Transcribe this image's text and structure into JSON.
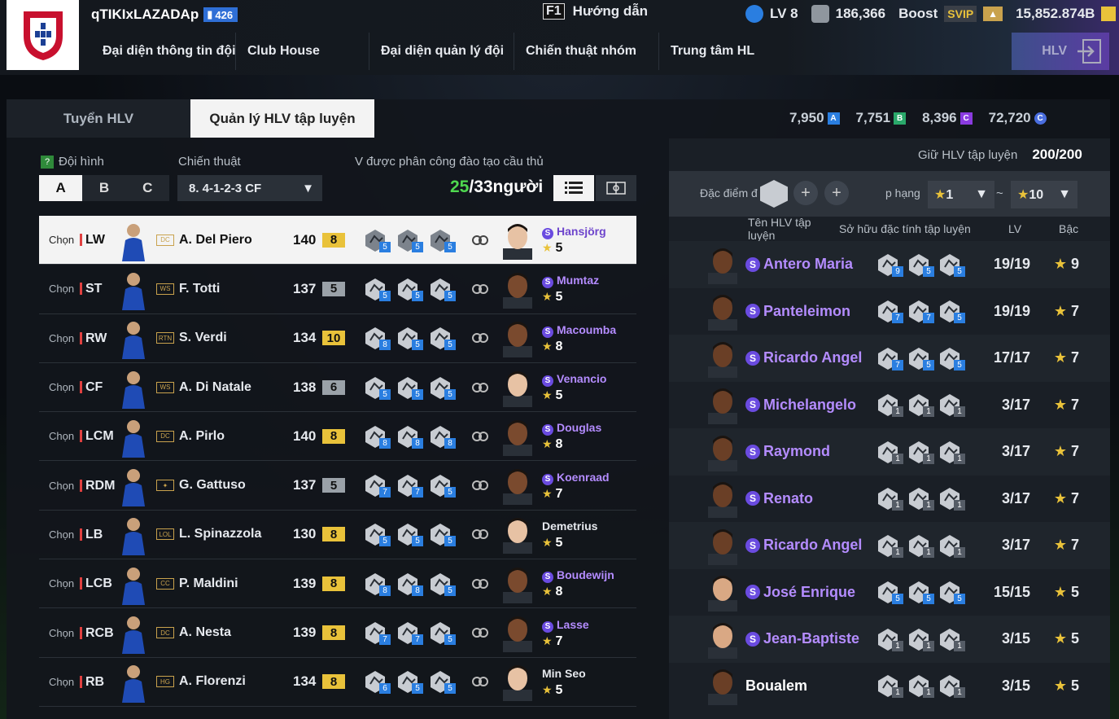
{
  "topbar": {
    "team_name": "qTIKIxLAZADAp",
    "team_level": "426",
    "guide_key": "F1",
    "guide_label": "Hướng dẫn",
    "level": "LV 8",
    "coins": "186,366",
    "boost_label": "Boost",
    "svip_label": "SVIP",
    "bp": "15,852.874B",
    "hlv_label": "HLV"
  },
  "nav": [
    "Đại diện thông tin đội",
    "Club House",
    "Đại diện quản lý đội",
    "Chiến thuật nhóm",
    "Trung tâm HL"
  ],
  "tabs": [
    "Tuyển HLV",
    "Quản lý HLV tập luyện"
  ],
  "currencies": [
    {
      "value": "7,950",
      "badge": "A",
      "color": "#2a7ee0"
    },
    {
      "value": "7,751",
      "badge": "B",
      "color": "#2aa86a"
    },
    {
      "value": "8,396",
      "badge": "C",
      "color": "#8a3be0"
    },
    {
      "value": "72,720",
      "badge": "C",
      "color": "#4a6ee0"
    }
  ],
  "left": {
    "formation_label": "Đội hình",
    "tactics_label": "Chiến thuật",
    "assigned_label": "V được phân công đào tạo cầu thủ",
    "formation_options": [
      "A",
      "B",
      "C"
    ],
    "tactic_value": "8. 4-1-2-3 CF",
    "assigned_count": "25",
    "assigned_total": "/33người"
  },
  "players": [
    {
      "choose": "Chọn",
      "pos": "LW",
      "season": "DC",
      "name": "A. Del Piero",
      "ovr": "140",
      "lvl": "8",
      "lvl_type": "gold",
      "traits": [
        "5",
        "5",
        "5"
      ],
      "coach": "Hansjörg",
      "coach_special": true,
      "stars": "5"
    },
    {
      "choose": "Chọn",
      "pos": "ST",
      "season": "WS",
      "name": "F. Totti",
      "ovr": "137",
      "lvl": "5",
      "lvl_type": "grey",
      "traits": [
        "5",
        "5",
        "5"
      ],
      "coach": "Mumtaz",
      "coach_special": true,
      "stars": "5"
    },
    {
      "choose": "Chọn",
      "pos": "RW",
      "season": "RTN",
      "name": "S. Verdi",
      "ovr": "134",
      "lvl": "10",
      "lvl_type": "gold",
      "traits": [
        "8",
        "5",
        "5"
      ],
      "coach": "Macoumba",
      "coach_special": true,
      "stars": "8"
    },
    {
      "choose": "Chọn",
      "pos": "CF",
      "season": "WS",
      "name": "A. Di Natale",
      "ovr": "138",
      "lvl": "6",
      "lvl_type": "grey",
      "traits": [
        "5",
        "5",
        "5"
      ],
      "coach": "Venancio",
      "coach_special": true,
      "stars": "5"
    },
    {
      "choose": "Chọn",
      "pos": "LCM",
      "season": "DC",
      "name": "A. Pirlo",
      "ovr": "140",
      "lvl": "8",
      "lvl_type": "gold",
      "traits": [
        "8",
        "8",
        "8"
      ],
      "coach": "Douglas",
      "coach_special": true,
      "stars": "8"
    },
    {
      "choose": "Chọn",
      "pos": "RDM",
      "season": "",
      "name": "G. Gattuso",
      "ovr": "137",
      "lvl": "5",
      "lvl_type": "grey",
      "traits": [
        "7",
        "7",
        "5"
      ],
      "coach": "Koenraad",
      "coach_special": true,
      "stars": "7"
    },
    {
      "choose": "Chọn",
      "pos": "LB",
      "season": "LOL",
      "name": "L. Spinazzola",
      "ovr": "130",
      "lvl": "8",
      "lvl_type": "gold",
      "traits": [
        "5",
        "5",
        "5"
      ],
      "coach": "Demetrius",
      "coach_special": false,
      "stars": "5"
    },
    {
      "choose": "Chọn",
      "pos": "LCB",
      "season": "CC",
      "name": "P. Maldini",
      "ovr": "139",
      "lvl": "8",
      "lvl_type": "gold",
      "traits": [
        "8",
        "8",
        "5"
      ],
      "coach": "Boudewijn",
      "coach_special": true,
      "stars": "8"
    },
    {
      "choose": "Chọn",
      "pos": "RCB",
      "season": "DC",
      "name": "A. Nesta",
      "ovr": "139",
      "lvl": "8",
      "lvl_type": "gold",
      "traits": [
        "7",
        "7",
        "5"
      ],
      "coach": "Lasse",
      "coach_special": true,
      "stars": "7"
    },
    {
      "choose": "Chọn",
      "pos": "RB",
      "season": "HG",
      "name": "A. Florenzi",
      "ovr": "134",
      "lvl": "8",
      "lvl_type": "gold",
      "traits": [
        "6",
        "5",
        "5"
      ],
      "coach": "Min Seo",
      "coach_special": false,
      "stars": "5"
    }
  ],
  "right": {
    "hold_label": "Giữ HLV tập luyện",
    "hold_value": "200/200",
    "trait_filter_label": "Đặc điểm đ",
    "rank_label": "p hạng",
    "rank_from": "1",
    "rank_to": "10",
    "tilde": "~",
    "col_name": "Tên HLV tập luyện",
    "col_trait": "Sở hữu đặc tính tập luyện",
    "col_lv": "LV",
    "col_rank": "Bậc"
  },
  "coaches": [
    {
      "name": "Antero Maria",
      "special": true,
      "traits": [
        "9",
        "5",
        "5"
      ],
      "lv": "19/19",
      "stars": "9"
    },
    {
      "name": "Panteleimon",
      "special": true,
      "traits": [
        "7",
        "7",
        "5"
      ],
      "lv": "19/19",
      "stars": "7"
    },
    {
      "name": "Ricardo Angel",
      "special": true,
      "traits": [
        "7",
        "5",
        "5"
      ],
      "lv": "17/17",
      "stars": "7"
    },
    {
      "name": "Michelangelo",
      "special": true,
      "traits": [
        "1",
        "1",
        "1"
      ],
      "lv": "3/17",
      "stars": "7"
    },
    {
      "name": "Raymond",
      "special": true,
      "traits": [
        "1",
        "1",
        "1"
      ],
      "lv": "3/17",
      "stars": "7"
    },
    {
      "name": "Renato",
      "special": true,
      "traits": [
        "1",
        "1",
        "1"
      ],
      "lv": "3/17",
      "stars": "7"
    },
    {
      "name": "Ricardo Angel",
      "special": true,
      "traits": [
        "1",
        "1",
        "1"
      ],
      "lv": "3/17",
      "stars": "7"
    },
    {
      "name": "José Enrique",
      "special": true,
      "traits": [
        "5",
        "5",
        "5"
      ],
      "lv": "15/15",
      "stars": "5"
    },
    {
      "name": "Jean-Baptiste",
      "special": true,
      "traits": [
        "1",
        "1",
        "1"
      ],
      "lv": "3/15",
      "stars": "5"
    },
    {
      "name": "Boualem",
      "special": false,
      "traits": [
        "1",
        "1",
        "1"
      ],
      "lv": "3/15",
      "stars": "5"
    }
  ]
}
